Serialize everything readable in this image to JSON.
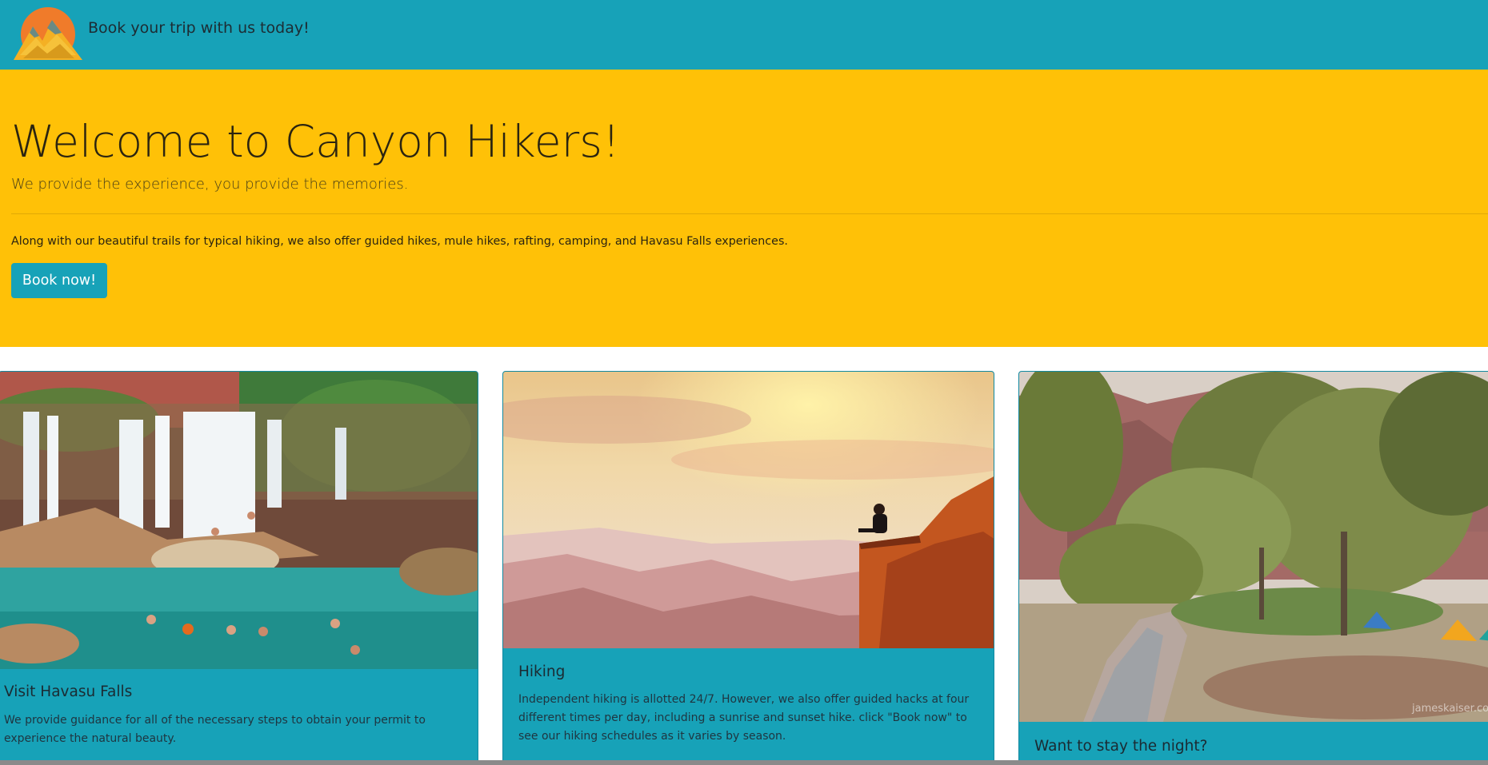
{
  "navbar": {
    "tagline": "Book your trip with us today!",
    "logo_icon": "mountain-sun-logo-icon",
    "background_color": "#17a2b8"
  },
  "jumbotron": {
    "title": "Welcome to Canyon Hikers!",
    "lead": "We provide the experience, you provide the memories.",
    "text": "Along with our beautiful trails for typical hiking, we also offer guided hikes, mule hikes, rafting, camping, and Havasu Falls experiences.",
    "button_label": "Book now!",
    "background_color": "#ffc107"
  },
  "cards": [
    {
      "image_icon": "waterfall-pool-image",
      "title": "Visit Havasu Falls",
      "text": "We provide guidance for all of the necessary steps to obtain your permit to experience the natural beauty."
    },
    {
      "image_icon": "canyon-cliff-hiker-image",
      "title": "Hiking",
      "text": "Independent hiking is allotted 24/7. However, we also offer guided hacks at four different times per day, including a sunrise and sunset hike. click \"Book now\" to see our hiking schedules as it varies by season."
    },
    {
      "image_icon": "canyon-campground-image",
      "title": "Want to stay the night?",
      "watermark": "jameskaiser.co"
    }
  ],
  "colors": {
    "accent_teal": "#17a2b8",
    "accent_yellow": "#ffc107"
  }
}
